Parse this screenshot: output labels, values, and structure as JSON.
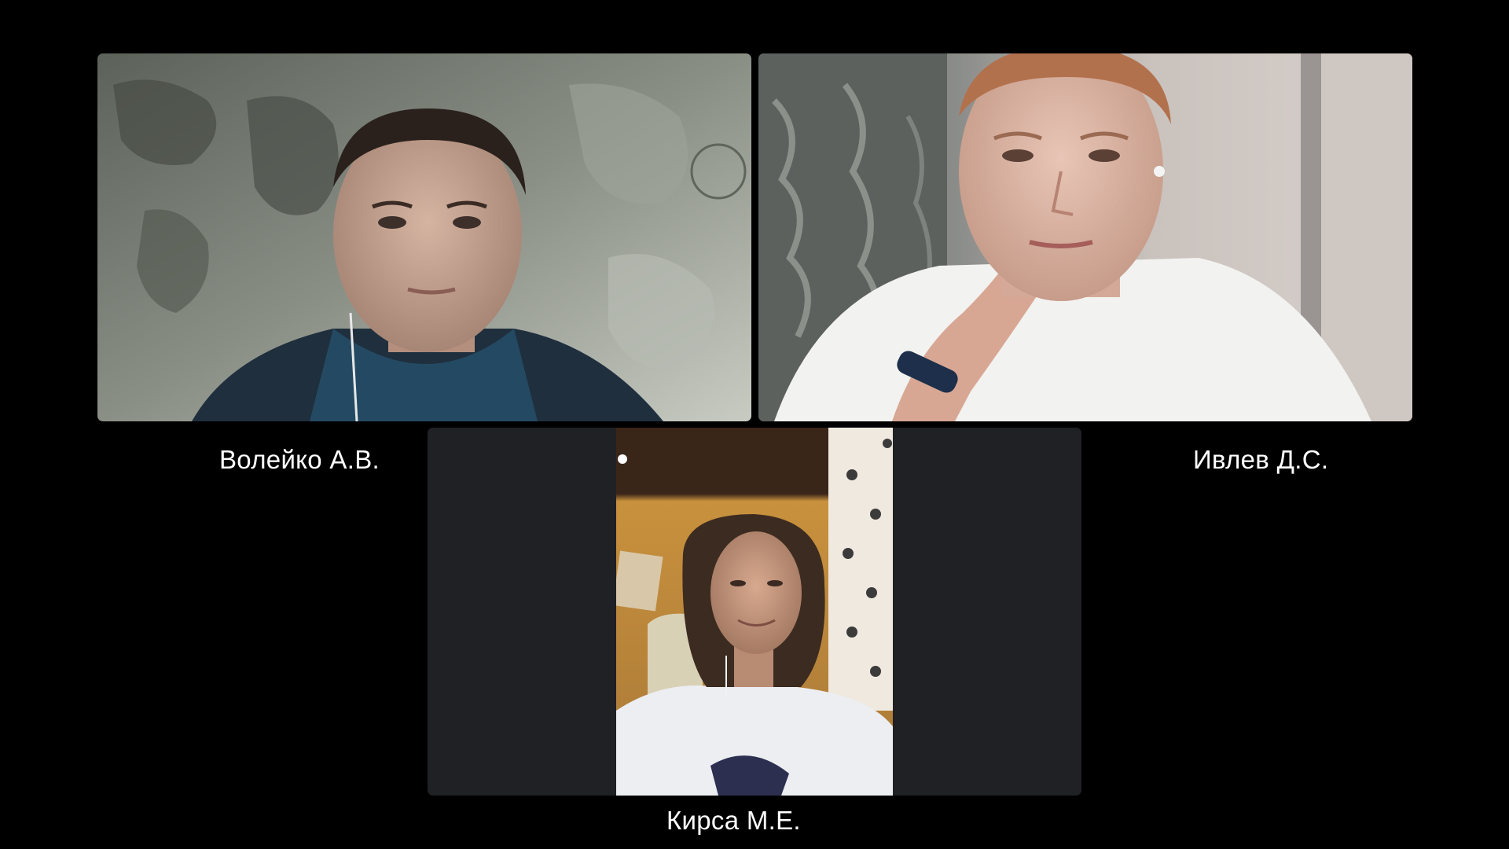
{
  "participants": [
    {
      "name": "Волейко А.В.",
      "tile_position": "top-left",
      "video": "camera-feed"
    },
    {
      "name": "Ивлев Д.С.",
      "tile_position": "top-right",
      "video": "camera-feed"
    },
    {
      "name": "Кирса М.Е.",
      "tile_position": "bottom-center",
      "video": "camera-feed-portrait"
    }
  ],
  "colors": {
    "background": "#000000",
    "tile_background": "#202124",
    "label_text": "#ffffff"
  },
  "icons": {
    "video_feed": "video-feed-icon"
  }
}
